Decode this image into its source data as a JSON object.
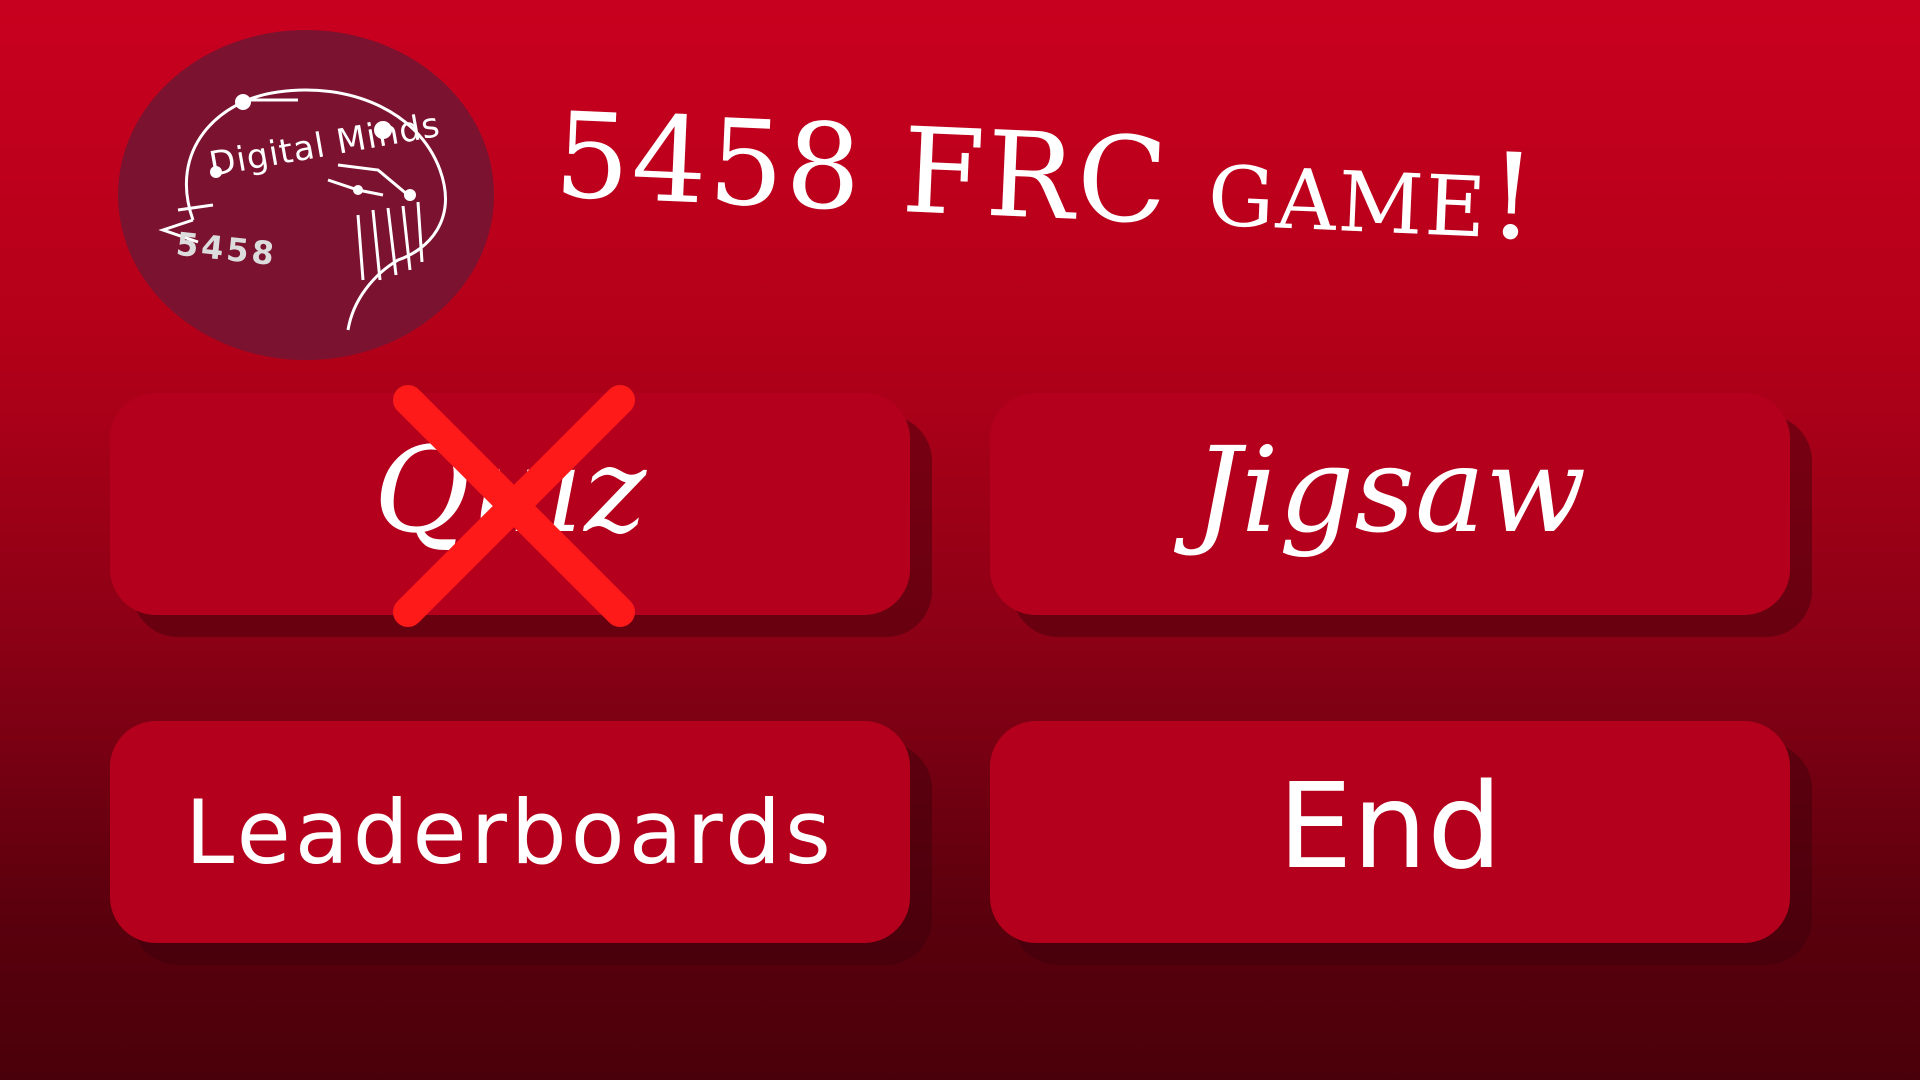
{
  "logo": {
    "brand_text": "Digital Minds",
    "number_text": "5458"
  },
  "title": "5458 FRC game!",
  "menu": {
    "quiz_label": "Quiz",
    "jigsaw_label": "Jigsaw",
    "leaderboards_label": "Leaderboards",
    "end_label": "End"
  },
  "quiz_status": "disabled-cross-icon",
  "colors": {
    "background_top": "#c8001f",
    "background_bottom": "#4a000a",
    "button": "#b5001d",
    "logo_circle": "#7a1230",
    "cross": "#ff1a1a"
  }
}
